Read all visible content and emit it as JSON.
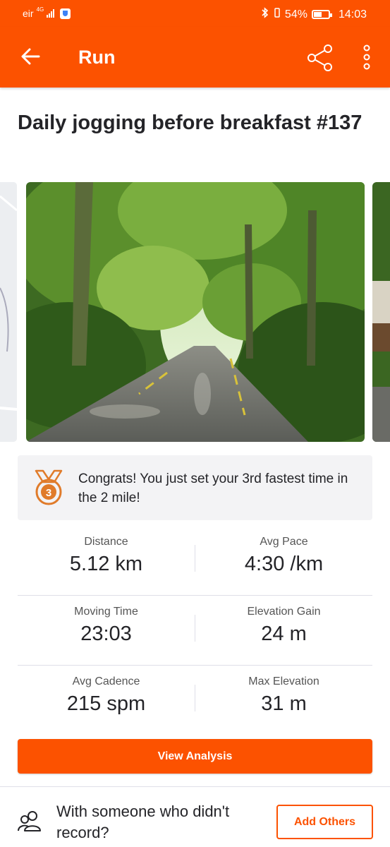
{
  "status_bar": {
    "carrier": "eir",
    "network": "4G",
    "battery": "54%",
    "time": "14:03"
  },
  "app_bar": {
    "title": "Run",
    "back_icon": "arrow-left-icon",
    "share_icon": "share-icon",
    "more_icon": "more-vertical-icon"
  },
  "activity": {
    "title": "Daily jogging before breakfast #137"
  },
  "achievement": {
    "icon": "medal-icon",
    "medal_rank": "3",
    "text": "Congrats! You just set your 3rd fastest time in the 2 mile!"
  },
  "stats": [
    {
      "left": {
        "label": "Distance",
        "value": "5.12 km"
      },
      "right": {
        "label": "Avg Pace",
        "value": "4:30 /km"
      }
    },
    {
      "left": {
        "label": "Moving Time",
        "value": "23:03"
      },
      "right": {
        "label": "Elevation Gain",
        "value": "24 m"
      }
    },
    {
      "left": {
        "label": "Avg Cadence",
        "value": "215 spm"
      },
      "right": {
        "label": "Max Elevation",
        "value": "31 m"
      }
    }
  ],
  "actions": {
    "view_analysis": "View Analysis",
    "with_someone": "With someone who didn't record?",
    "add_others": "Add Others"
  },
  "colors": {
    "brand": "#fc5200",
    "medal": "#e07b2a",
    "panel": "#f3f3f5"
  }
}
